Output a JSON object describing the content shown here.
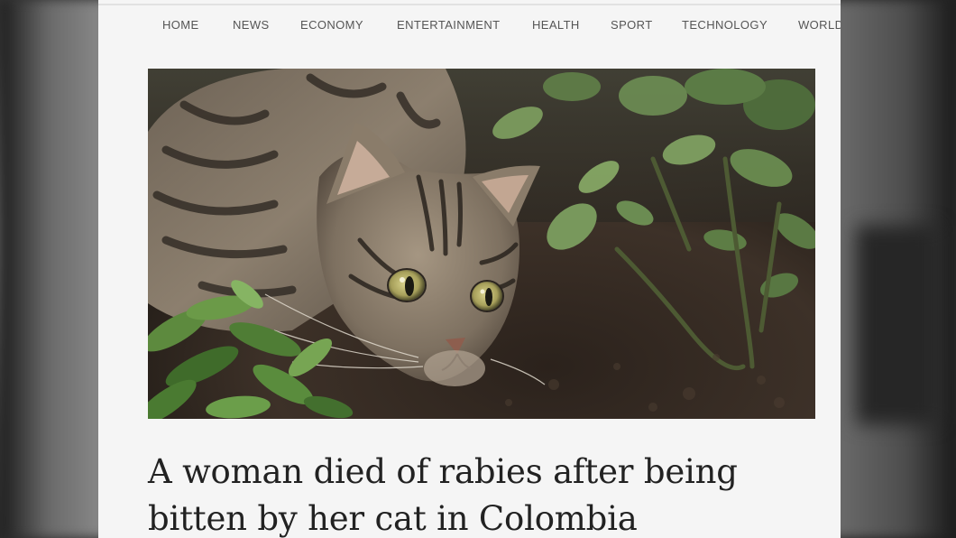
{
  "nav": {
    "items": [
      {
        "label": "HOME"
      },
      {
        "label": "NEWS"
      },
      {
        "label": "ECONOMY"
      },
      {
        "label": "ENTERTAINMENT"
      },
      {
        "label": "HEALTH"
      },
      {
        "label": "SPORT"
      },
      {
        "label": "TECHNOLOGY"
      },
      {
        "label": "WORLD"
      }
    ]
  },
  "article": {
    "headline": "A woman died of rabies after being bitten by her cat in Colombia",
    "image_subject": "tabby cat crouching among green plants"
  },
  "colors": {
    "nav_text": "#555555",
    "headline_text": "#222222",
    "page_background": "#f5f5f5"
  }
}
